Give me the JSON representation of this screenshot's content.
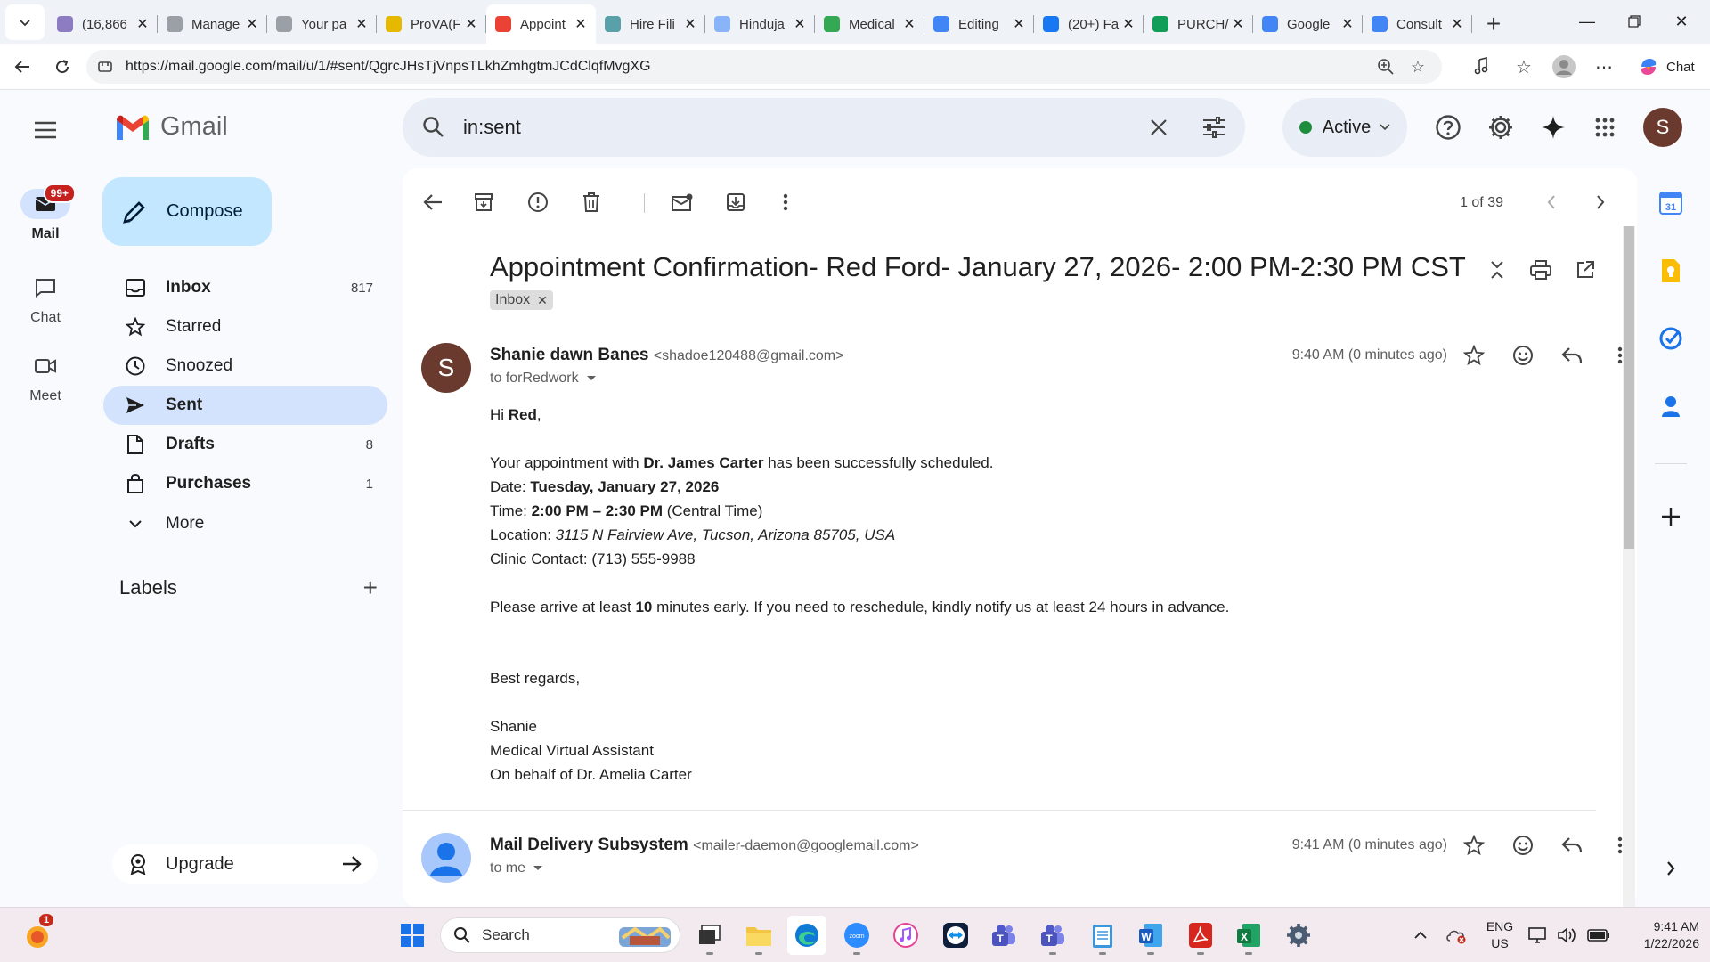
{
  "browser": {
    "tabs": [
      {
        "label": "(16,866",
        "icon": "mail-icon",
        "color": "#8e7cc3"
      },
      {
        "label": "Manage",
        "icon": "globe-icon",
        "color": "#9aa0a6"
      },
      {
        "label": "Your pa",
        "icon": "globe-icon",
        "color": "#9aa0a6"
      },
      {
        "label": "ProVA(F",
        "icon": "prova-icon",
        "color": "#e6b800"
      },
      {
        "label": "Appoint",
        "icon": "gmail-icon",
        "color": "#ea4335"
      },
      {
        "label": "Hire Fili",
        "icon": "hire-icon",
        "color": "#5aa0a8"
      },
      {
        "label": "Hinduja",
        "icon": "globe-icon",
        "color": "#8ab4f8"
      },
      {
        "label": "Medical",
        "icon": "drive-icon",
        "color": "#34a853"
      },
      {
        "label": "Editing",
        "icon": "globe-icon",
        "color": "#4285f4"
      },
      {
        "label": "(20+) Fa",
        "icon": "facebook-icon",
        "color": "#1877f2"
      },
      {
        "label": "PURCH/",
        "icon": "sheets-plus-icon",
        "color": "#0f9d58"
      },
      {
        "label": "Google",
        "icon": "calendar-icon",
        "color": "#4285f4"
      },
      {
        "label": "Consult",
        "icon": "calendar-icon",
        "color": "#4285f4"
      }
    ],
    "active_tab_index": 4,
    "url": "https://mail.google.com/mail/u/1/#sent/QgrcJHsTjVnpsTLkhZmhgtmJCdClqfMvgXG",
    "chat_label": "Chat"
  },
  "rail": {
    "mail_label": "Mail",
    "mail_badge": "99+",
    "chat_label": "Chat",
    "meet_label": "Meet"
  },
  "header": {
    "wordmark": "Gmail",
    "search_query": "in:sent",
    "status_label": "Active",
    "avatar_letter": "S"
  },
  "nav": {
    "compose_label": "Compose",
    "items": [
      {
        "label": "Inbox",
        "count": "817",
        "icon": "inbox-icon"
      },
      {
        "label": "Starred",
        "count": "",
        "icon": "star-icon"
      },
      {
        "label": "Snoozed",
        "count": "",
        "icon": "clock-icon"
      },
      {
        "label": "Sent",
        "count": "",
        "icon": "send-icon"
      },
      {
        "label": "Drafts",
        "count": "8",
        "icon": "draft-icon"
      },
      {
        "label": "Purchases",
        "count": "1",
        "icon": "shopping-bag-icon"
      },
      {
        "label": "More",
        "count": "",
        "icon": "chevron-down-icon"
      }
    ],
    "labels_heading": "Labels",
    "upgrade_label": "Upgrade"
  },
  "thread": {
    "pager": "1 of 39",
    "subject": "Appointment Confirmation- Red Ford- January 27, 2026- 2:00 PM-2:30 PM CST",
    "label_chip": "Inbox",
    "message1": {
      "avatar_letter": "S",
      "sender_name": "Shanie dawn Banes",
      "sender_email": "<shadoe120488@gmail.com>",
      "to": "to forRedwork",
      "time": "9:40 AM (0 minutes ago)",
      "greeting_pre": "Hi ",
      "greeting_name": "Red",
      "greeting_post": ",",
      "line1_pre": "Your appointment with ",
      "line1_doctor": "Dr. James Carter",
      "line1_post": " has been successfully scheduled.",
      "date_label": "Date: ",
      "date_value": "Tuesday, January 27, 2026",
      "time_label": "Time: ",
      "time_value": "2:00 PM – 2:30 PM",
      "time_zone": " (Central Time)",
      "location_label": "Location: ",
      "location_value": "3115 N Fairview Ave, Tucson, Arizona 85705, USA",
      "contact": "Clinic Contact: (713) 555-9988",
      "arrive_pre": "Please arrive at least ",
      "arrive_minutes": "10",
      "arrive_post": " minutes early. If you need to reschedule, kindly notify us at least 24 hours in advance.",
      "closing": "Best regards,",
      "sig_name": "Shanie",
      "sig_title": "Medical Virtual Assistant",
      "sig_behalf": "On behalf of Dr. Amelia Carter"
    },
    "message2": {
      "sender_name": "Mail Delivery Subsystem",
      "sender_email": "<mailer-daemon@googlemail.com>",
      "to": "to me",
      "time": "9:41 AM (0 minutes ago)"
    }
  },
  "taskbar": {
    "search_placeholder": "Search",
    "notification_count": "1",
    "lang_top": "ENG",
    "lang_bottom": "US",
    "clock_time": "9:41 AM",
    "clock_date": "1/22/2026"
  }
}
